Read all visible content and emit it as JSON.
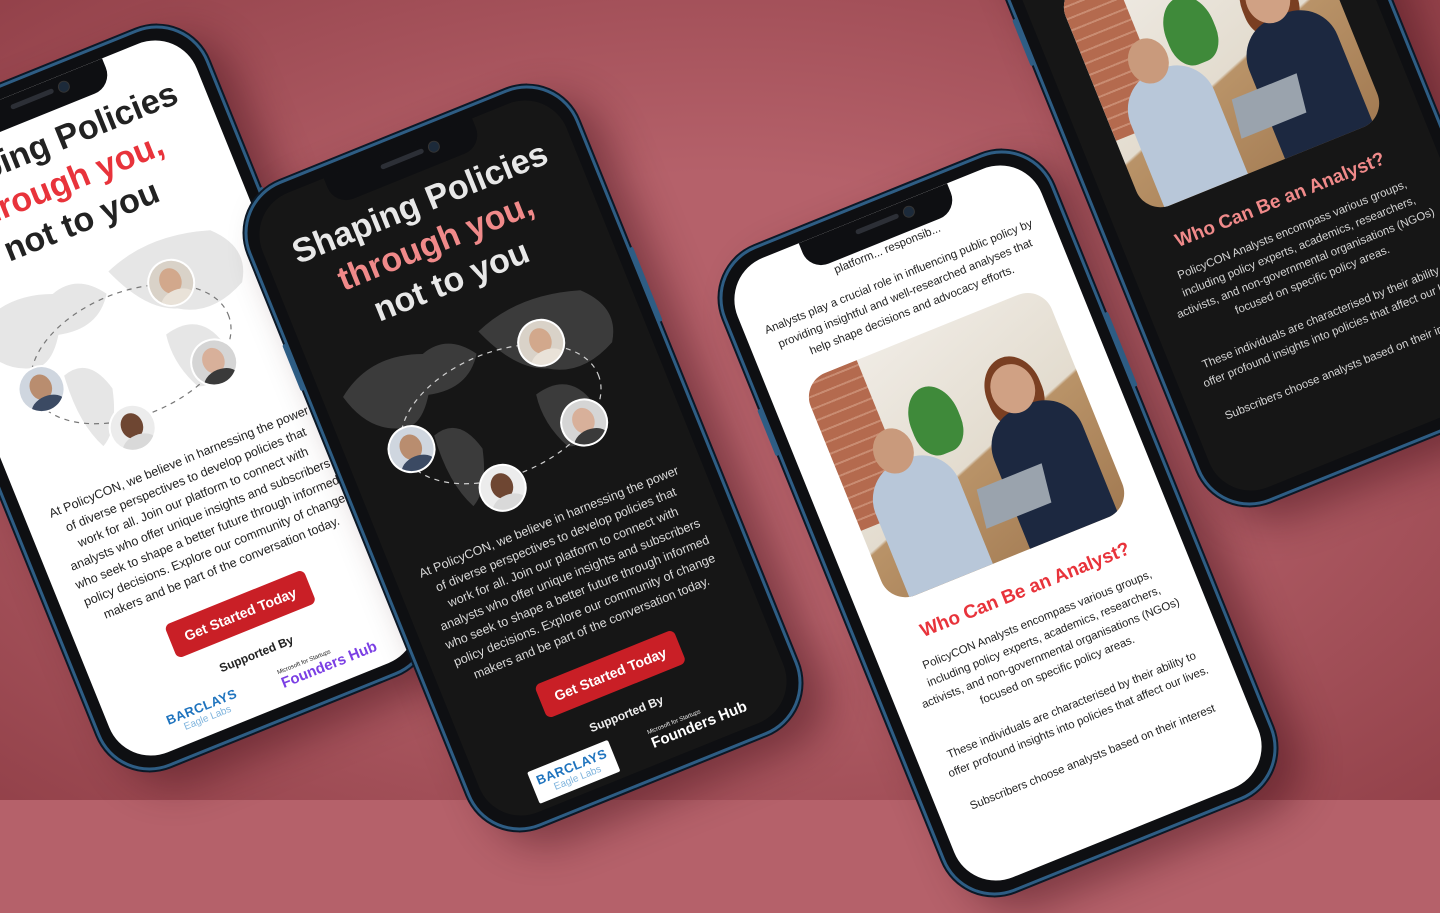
{
  "hero": {
    "line1": "Shaping Policies",
    "line2": "through you,",
    "line3": "not to you"
  },
  "intro": "At PolicyCON, we believe in harnessing the power of diverse perspectives to develop policies that work for all. Join our platform to connect with analysts who offer unique insights and subscribers who seek to shape a better future through informed policy decisions. Explore our community of change makers and be part of the conversation today.",
  "cta_label": "Get Started Today",
  "supported_label": "Supported By",
  "logos": {
    "barclays_main": "BARCLAYS",
    "barclays_sub": "Eagle Labs",
    "fh_small": "Microsoft for Startups",
    "fh_main": "Founders Hub"
  },
  "analysts": {
    "prev_fragment": "platform... responsib...",
    "role_text": "Analysts play a crucial role in influencing public policy by providing insightful and well-researched analyses that help shape decisions and advocacy efforts.",
    "heading": "Who Can Be an Analyst?",
    "groups_text": "PolicyCON Analysts encompass various groups, including policy experts, academics, researchers, activists, and non-governmental organisations (NGOs) focused on specific policy areas.",
    "traits_text": "These individuals are characterised by their ability to offer profound insights into policies that affect our lives.",
    "subscribers_text": "Subscribers choose analysts based on their interest"
  },
  "colors": {
    "background": "#b5616a",
    "accent_red": "#e8333b",
    "accent_pink": "#f08a8a",
    "cta": "#c91f26",
    "frame": "#2e5d84"
  }
}
